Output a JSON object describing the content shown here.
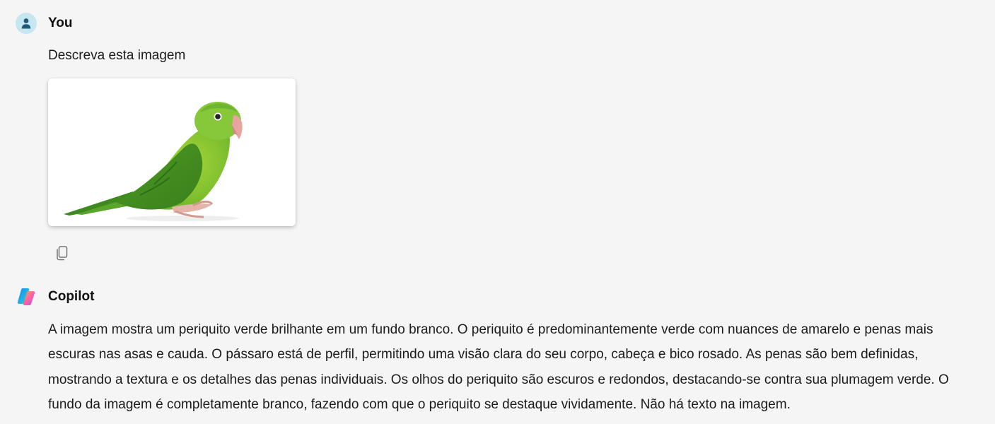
{
  "user_message": {
    "author": "You",
    "text": "Descreva esta imagem",
    "image": "parakeet-photo",
    "copy_icon": "copy-icon"
  },
  "assistant_message": {
    "author": "Copilot",
    "text": "A imagem mostra um periquito verde brilhante em um fundo branco. O periquito é predominantemente verde com nuances de amarelo e penas mais escuras nas asas e cauda. O pássaro está de perfil, permitindo uma visão clara do seu corpo, cabeça e bico rosado. As penas são bem definidas, mostrando a textura e os detalhes das penas individuais. Os olhos do periquito são escuros e redondos, destacando-se contra sua plumagem verde. O fundo da imagem é completamente branco, fazendo com que o periquito se destaque vividamente. Não há texto na imagem."
  },
  "colors": {
    "background": "#f5f5f5",
    "user_avatar_bg": "#c6e6f0",
    "user_avatar_fg": "#1e5a78",
    "text": "#1b1b1b"
  }
}
